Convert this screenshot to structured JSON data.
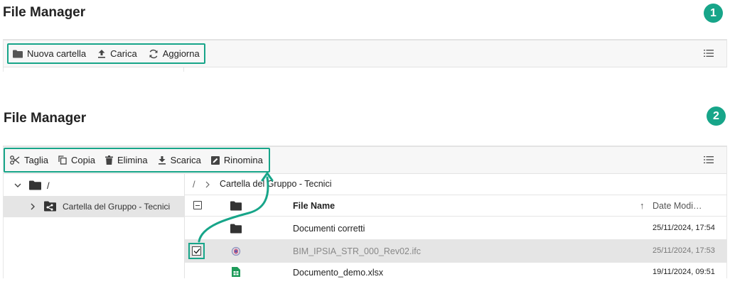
{
  "colors": {
    "accent": "#17a589",
    "folder": "#333333",
    "selected_row": "#e5e5e5"
  },
  "panel1": {
    "title": "File Manager",
    "badge": "1",
    "toolbar": {
      "new_folder": {
        "label": "Nuova cartella",
        "icon": "folder-icon"
      },
      "upload": {
        "label": "Carica",
        "icon": "upload-icon"
      },
      "refresh": {
        "label": "Aggiorna",
        "icon": "refresh-icon"
      },
      "view": {
        "icon": "list-view-icon"
      }
    }
  },
  "panel2": {
    "title": "File Manager",
    "badge": "2",
    "toolbar": {
      "cut": {
        "label": "Taglia",
        "icon": "scissors-icon"
      },
      "copy": {
        "label": "Copia",
        "icon": "copy-icon"
      },
      "delete": {
        "label": "Elimina",
        "icon": "trash-icon"
      },
      "download": {
        "label": "Scarica",
        "icon": "download-icon"
      },
      "rename": {
        "label": "Rinomina",
        "icon": "rename-icon"
      },
      "view": {
        "icon": "list-view-icon"
      }
    },
    "tree": {
      "root": {
        "label": "/"
      },
      "child": {
        "label": "Cartella del Gruppo - Tecnici"
      }
    },
    "breadcrumb": {
      "root": "/",
      "separator": ">",
      "current": "Cartella del Gruppo - Tecnici"
    },
    "grid": {
      "header": {
        "name": "File Name",
        "date": "Date Modi…",
        "sort_arrow": "↑"
      },
      "rows": [
        {
          "name": "Documenti corretti",
          "date": "25/11/2024, 17:54",
          "type": "folder",
          "selected": false
        },
        {
          "name": "BIM_IPSIA_STR_000_Rev02.ifc",
          "date": "25/11/2024, 17:53",
          "type": "ifc",
          "selected": true
        },
        {
          "name": "Documento_demo.xlsx",
          "date": "19/11/2024, 09:51",
          "type": "xlsx",
          "selected": false
        }
      ]
    }
  }
}
